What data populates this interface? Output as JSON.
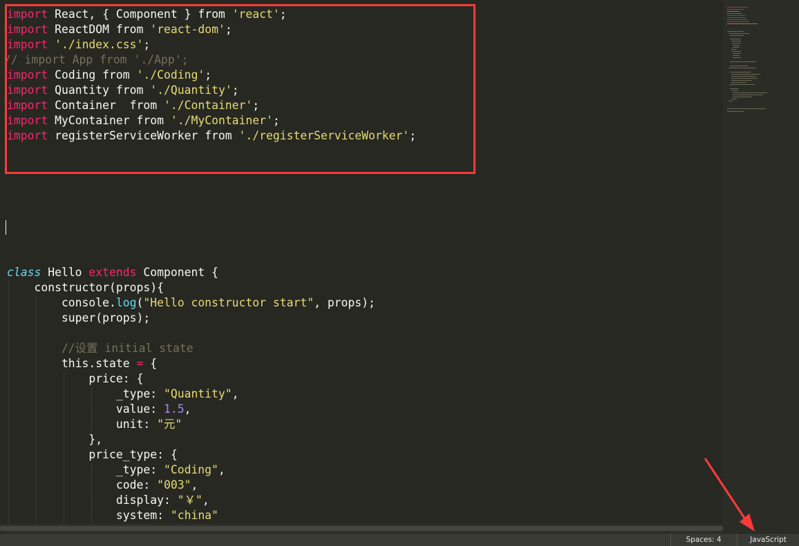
{
  "editor": {
    "lines": {
      "l1": {
        "k": "import",
        "a": " React, { Component } ",
        "f": "from",
        "s": "'react'",
        "e": ";"
      },
      "l2": {
        "k": "import",
        "a": " ReactDOM ",
        "f": "from",
        "s": "'react-dom'",
        "e": ";"
      },
      "l3": {
        "k": "import",
        "a": " ",
        "s": "'./index.css'",
        "e": ";"
      },
      "l4": {
        "c": "// import App from './App';"
      },
      "l5": {
        "k": "import",
        "a": " Coding ",
        "f": "from",
        "s": "'./Coding'",
        "e": ";"
      },
      "l6": {
        "k": "import",
        "a": " Quantity ",
        "f": "from",
        "s": "'./Quantity'",
        "e": ";"
      },
      "l7": {
        "k": "import",
        "a": " Container  ",
        "f": "from",
        "s": "'./Container'",
        "e": ";"
      },
      "l8": {
        "k": "import",
        "a": " MyContainer ",
        "f": "from",
        "s": "'./MyContainer'",
        "e": ";"
      },
      "l9": {
        "k": "import",
        "a": " registerServiceWorker ",
        "f": "from",
        "s": "'./registerServiceWorker'",
        "e": ";"
      },
      "l10": {
        "c1": "class",
        "a": " Hello ",
        "k": "extends",
        "b": " Component {"
      },
      "l11": {
        "a": "    constructor(props){"
      },
      "l12": {
        "a": "        console.",
        "f": "log",
        "b": "(",
        "s": "\"Hello constructor start\"",
        "e": ", props);"
      },
      "l13": {
        "a": "        super(props);"
      },
      "l14": {
        "c": "        //设置 initial state"
      },
      "l15": {
        "a": "        this.state ",
        "o": "=",
        "b": " {"
      },
      "l16": {
        "a": "            price: {"
      },
      "l17": {
        "a": "                _type: ",
        "s": "\"Quantity\"",
        "e": ","
      },
      "l18": {
        "a": "                value: ",
        "n": "1.5",
        "e": ","
      },
      "l19": {
        "a": "                unit: ",
        "s": "\"元\""
      },
      "l20": {
        "a": "            },"
      },
      "l21": {
        "a": "            price_type: {"
      },
      "l22": {
        "a": "                _type: ",
        "s": "\"Coding\"",
        "e": ","
      },
      "l23": {
        "a": "                code: ",
        "s": "\"003\"",
        "e": ","
      },
      "l24": {
        "a": "                display: ",
        "s": "\"￥\"",
        "e": ","
      },
      "l25": {
        "a": "                system: ",
        "s": "\"china\""
      }
    }
  },
  "status": {
    "spaces": "Spaces: 4",
    "syntax": "JavaScript"
  },
  "colors": {
    "background": "#272822",
    "keyword": "#f92672",
    "string": "#e6db74",
    "comment": "#75715e",
    "storage": "#66d9ef",
    "number": "#ae81ff",
    "annotation": "#ff3a3a"
  }
}
